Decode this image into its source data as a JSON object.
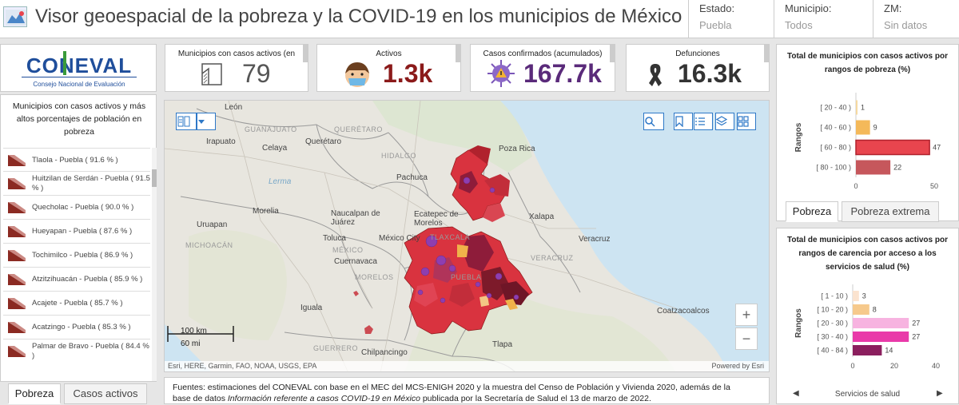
{
  "header": {
    "title": "Visor geoespacial de la pobreza y la COVID-19 en los municipios de México",
    "selectors": [
      {
        "label": "Estado:",
        "value": "Puebla"
      },
      {
        "label": "Municipio:",
        "value": "Todos"
      },
      {
        "label": "ZM:",
        "value": "Sin datos"
      }
    ]
  },
  "logo": {
    "name": "CONEVAL",
    "subtitle": "Consejo Nacional de Evaluación"
  },
  "kpis": [
    {
      "label": "Municipios con casos activos (en",
      "value": "79",
      "color": "#555555",
      "icon": "map-area-icon"
    },
    {
      "label": "Activos",
      "value": "1.3k",
      "color": "#8b1a1a",
      "icon": "masked-person-icon"
    },
    {
      "label": "Casos confirmados (acumulados)",
      "value": "167.7k",
      "color": "#5a2a7a",
      "icon": "virus-icon"
    },
    {
      "label": "Defunciones",
      "value": "16.3k",
      "color": "#333333",
      "icon": "mourning-ribbon-icon"
    }
  ],
  "left_panel": {
    "title": "Municipios con casos activos y más altos porcentajes de población en pobreza",
    "items": [
      "Tlaola - Puebla ( 91.6 % )",
      "Huitzilan de Serdán - Puebla ( 91.5 % )",
      "Quecholac - Puebla ( 90.0 % )",
      "Hueyapan - Puebla ( 87.6 % )",
      "Tochimilco - Puebla ( 86.9 % )",
      "Atzitzihuacán - Puebla ( 85.9 % )",
      "Acajete - Puebla ( 85.7 % )",
      "Acatzingo - Puebla ( 85.3 % )",
      "Palmar de Bravo - Puebla ( 84.4 % )"
    ],
    "tabs": [
      "Pobreza",
      "Casos activos"
    ]
  },
  "map": {
    "labels": [
      {
        "text": "León",
        "kind": "city"
      },
      {
        "text": "GUANAJUATO",
        "kind": "state"
      },
      {
        "text": "QUERÉTARO",
        "kind": "state"
      },
      {
        "text": "Irapuato",
        "kind": "city"
      },
      {
        "text": "Celaya",
        "kind": "city"
      },
      {
        "text": "Querétaro",
        "kind": "city"
      },
      {
        "text": "HIDALGO",
        "kind": "state"
      },
      {
        "text": "Poza Rica",
        "kind": "city"
      },
      {
        "text": "Pachuca",
        "kind": "city"
      },
      {
        "text": "Uruapan",
        "kind": "city"
      },
      {
        "text": "Morelia",
        "kind": "city"
      },
      {
        "text": "Naucalpan de Juárez",
        "kind": "city"
      },
      {
        "text": "Ecatepec de Morelos",
        "kind": "city"
      },
      {
        "text": "Xalapa",
        "kind": "city"
      },
      {
        "text": "TLAXCALA",
        "kind": "state"
      },
      {
        "text": "Toluca",
        "kind": "city"
      },
      {
        "text": "México City",
        "kind": "city"
      },
      {
        "text": "Veracruz",
        "kind": "city"
      },
      {
        "text": "MICHOACÁN",
        "kind": "state"
      },
      {
        "text": "MÉXICO",
        "kind": "state"
      },
      {
        "text": "Cuernavaca",
        "kind": "city"
      },
      {
        "text": "VERACRUZ",
        "kind": "state"
      },
      {
        "text": "MORELOS",
        "kind": "state"
      },
      {
        "text": "PUEBLA",
        "kind": "state"
      },
      {
        "text": "Coatzacoalcos",
        "kind": "city"
      },
      {
        "text": "Iguala",
        "kind": "city"
      },
      {
        "text": "Chilpancingo",
        "kind": "city"
      },
      {
        "text": "GUERRERO",
        "kind": "state"
      },
      {
        "text": "Tlapa",
        "kind": "city"
      }
    ],
    "lerma_label": "Lerma",
    "attribution": "Esri, HERE, Garmin, FAO, NOAA, USGS, EPA",
    "powered": "Powered by Esri",
    "scale_km": "100 km",
    "scale_mi": "60 mi",
    "zoom_in": "+",
    "zoom_out": "−"
  },
  "footer": {
    "line1": "Fuentes: estimaciones del CONEVAL con base en el MEC del MCS-ENIGH 2020 y la muestra del Censo de Población y Vivienda 2020, además de la",
    "line2a": "base de datos ",
    "line2b": "Información referente a casos COVID-19 en México",
    "line2c": " publicada por la Secretaría de Salud el 13 de marzo de 2022."
  },
  "right_panel": {
    "tabs": [
      "Pobreza",
      "Pobreza extrema"
    ],
    "bottom_label": "Servicios de salud"
  },
  "chart_data": [
    {
      "type": "bar",
      "orientation": "horizontal",
      "title": "Total de municipios con casos activos por rangos de pobreza (%)",
      "ylabel": "Rangos",
      "categories": [
        "[ 20 - 40 )",
        "[ 40 - 60 )",
        "[ 60 - 80 )",
        "[ 80 - 100 )"
      ],
      "values": [
        1,
        9,
        47,
        22
      ],
      "colors": [
        "#f6d9a0",
        "#f4b95a",
        "#e8454e",
        "#c6575c"
      ],
      "xlim": [
        0,
        50
      ],
      "xticks": [
        0,
        50
      ]
    },
    {
      "type": "bar",
      "orientation": "horizontal",
      "title": "Total de municipios con casos activos por rangos de carencia por acceso a los servicios de salud (%)",
      "ylabel": "Rangos",
      "categories": [
        "[ 1 - 10 )",
        "[ 10 - 20 )",
        "[ 20 - 30 )",
        "[ 30 - 40 )",
        "[ 40 - 84 )"
      ],
      "values": [
        3,
        8,
        27,
        27,
        14
      ],
      "colors": [
        "#fbe3cf",
        "#f6c98c",
        "#f7b3e0",
        "#e93aa9",
        "#8b1f5e"
      ],
      "xlim": [
        0,
        40
      ],
      "xticks": [
        0,
        20,
        40
      ]
    }
  ]
}
